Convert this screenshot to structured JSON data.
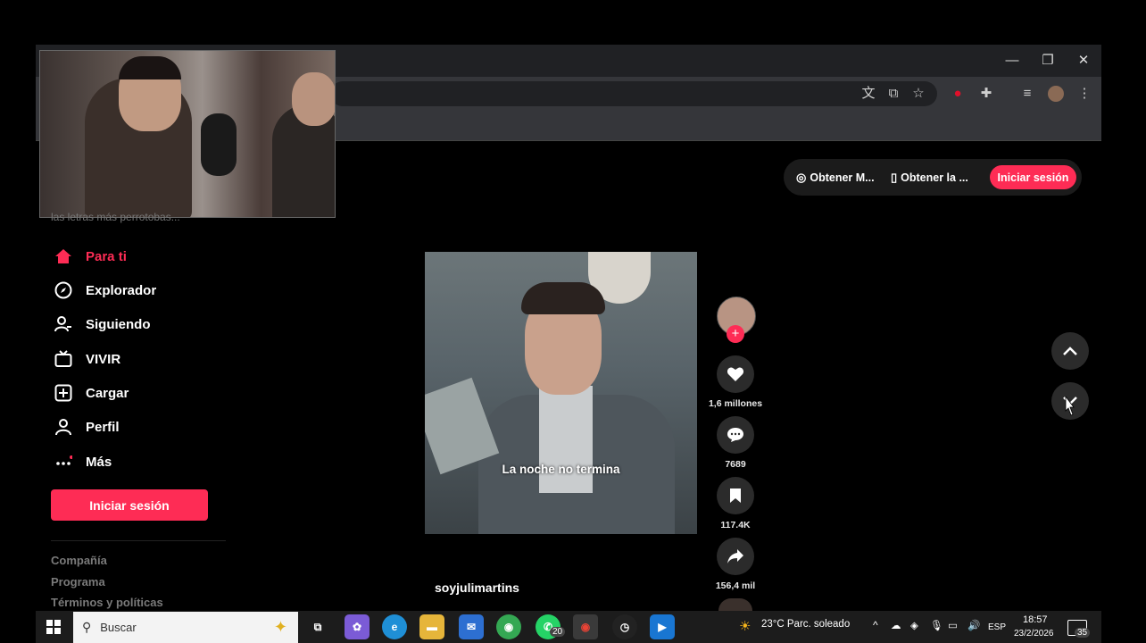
{
  "browser": {
    "window_controls": {
      "minimize": "—",
      "restore": "❐",
      "close": "✕"
    }
  },
  "search": {
    "placeholder": "las letras más perrotobas..."
  },
  "sidebar": {
    "items": [
      {
        "label": "Para ti",
        "icon": "home-icon",
        "active": true
      },
      {
        "label": "Explorador",
        "icon": "compass-icon"
      },
      {
        "label": "Siguiendo",
        "icon": "following-icon"
      },
      {
        "label": "VIVIR",
        "icon": "live-tv-icon"
      },
      {
        "label": "Cargar",
        "icon": "upload-icon"
      },
      {
        "label": "Perfil",
        "icon": "profile-icon"
      },
      {
        "label": "Más",
        "icon": "more-icon"
      }
    ],
    "login_label": "Iniciar sesión",
    "footer": [
      "Compañía",
      "Programa",
      "Términos y políticas"
    ]
  },
  "top_bar": {
    "get_coins": "Obtener M...",
    "get_app": "Obtener la ...",
    "login": "Iniciar sesión"
  },
  "video": {
    "caption": "La noche no termina",
    "author": "soyjulimartins",
    "likes": "1,6 millones",
    "comments": "7689",
    "saves": "117.4K",
    "shares": "156,4 mil"
  },
  "taskbar": {
    "search_label": "Buscar",
    "whatsapp_badge": "20",
    "weather": "23°C  Parc. soleado",
    "language": "ESP",
    "time": "18:57",
    "date": "23/2/2026",
    "notifications": "35"
  },
  "colors": {
    "accent": "#fe2c55",
    "background": "#000000",
    "chrome": "#35363a"
  }
}
